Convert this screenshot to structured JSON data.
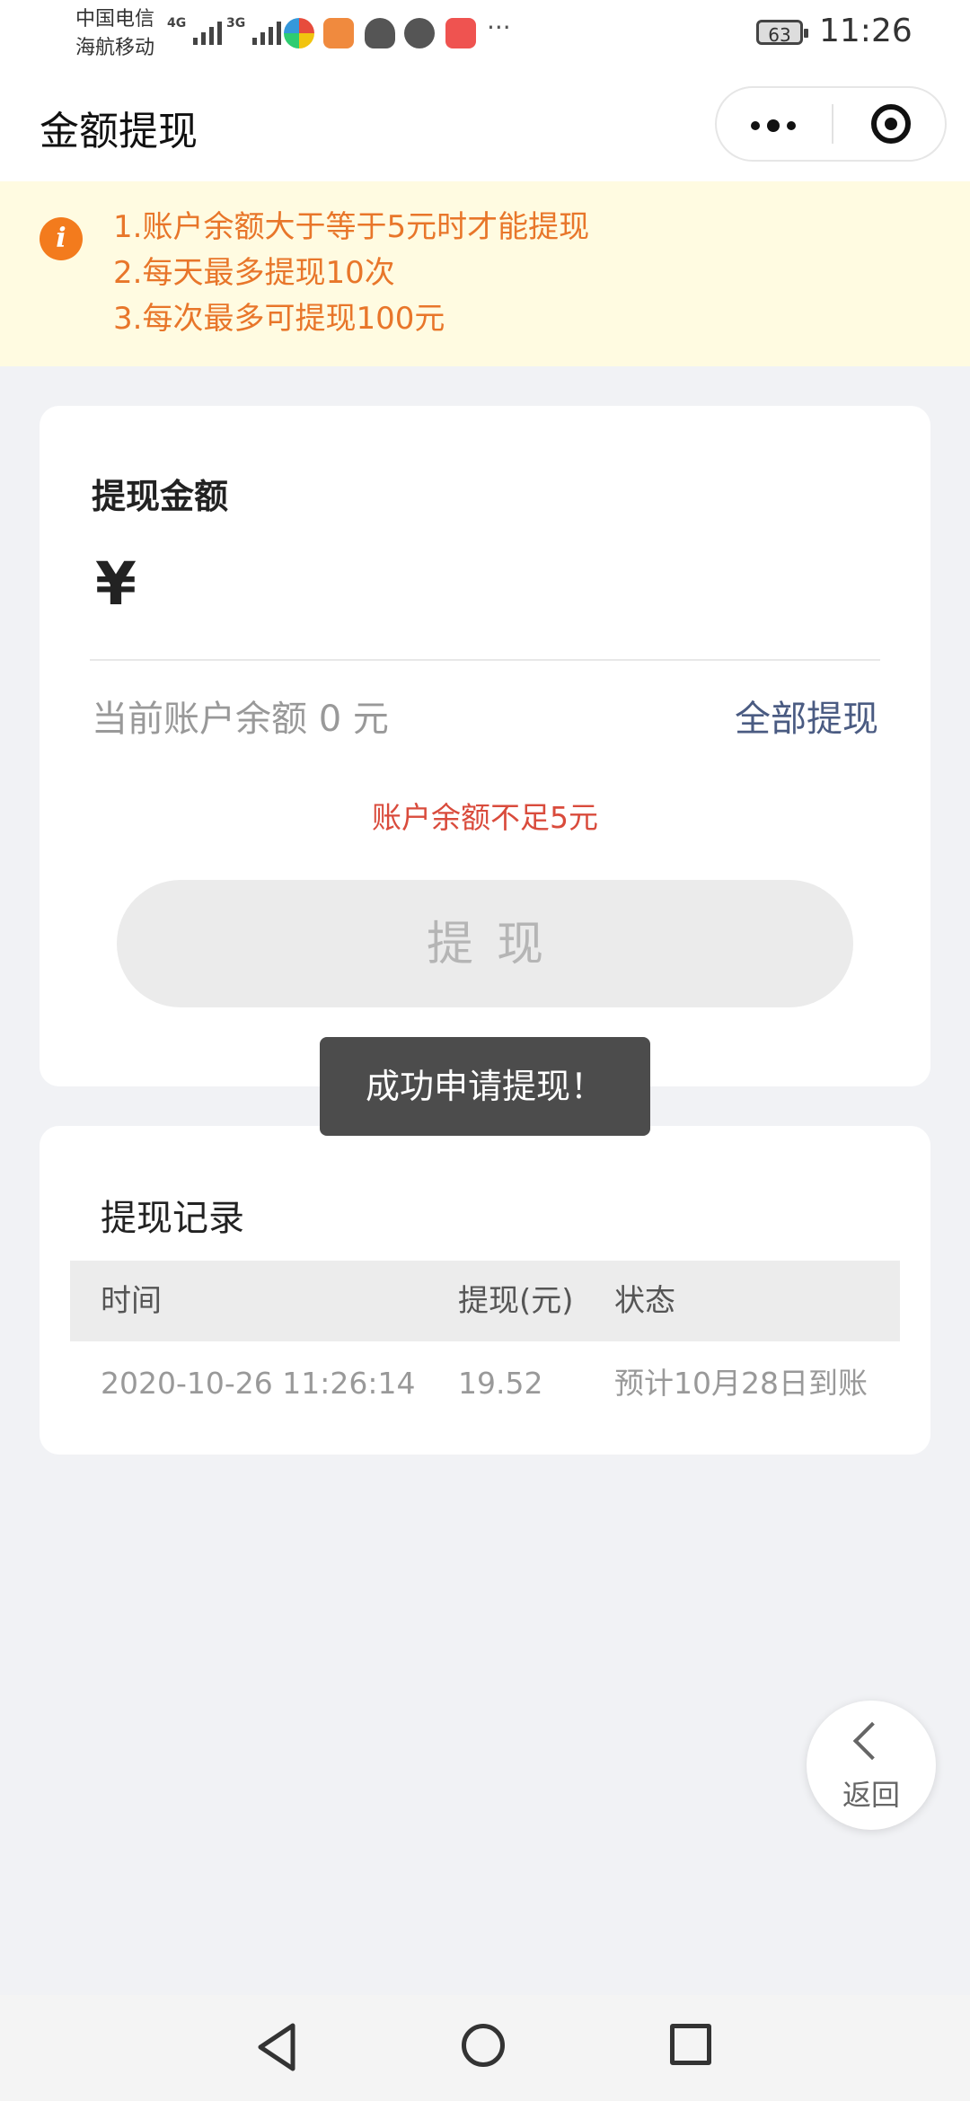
{
  "status_bar": {
    "carrier_1": "中国电信",
    "carrier_2": "海航移动",
    "signal_1_tag": "4G",
    "signal_2_tag": "3G",
    "overflow": "···",
    "battery": "63",
    "time": "11:26"
  },
  "nav": {
    "title": "金额提现"
  },
  "notice": {
    "lines": [
      "1.账户余额大于等于5元时才能提现",
      "2.每天最多提现10次",
      "3.每次最多可提现100元"
    ]
  },
  "withdraw_form": {
    "label": "提现金额",
    "currency_symbol": "¥",
    "amount_value": "",
    "balance_text": "当前账户余额 0 元",
    "withdraw_all_label": "全部提现",
    "error_message": "账户余额不足5元",
    "submit_label": "提现"
  },
  "toast": {
    "message": "成功申请提现！"
  },
  "records": {
    "title": "提现记录",
    "columns": [
      "时间",
      "提现(元)",
      "状态"
    ],
    "rows": [
      [
        "2020-10-26 11:26:14",
        "19.52",
        "预计10月28日到账"
      ]
    ]
  },
  "back_button": {
    "label": "返回"
  },
  "colors": {
    "accent_orange": "#e8762a",
    "error_red": "#d94b3c",
    "link_blue": "#4a5b82",
    "notice_bg": "#fffbe1"
  }
}
